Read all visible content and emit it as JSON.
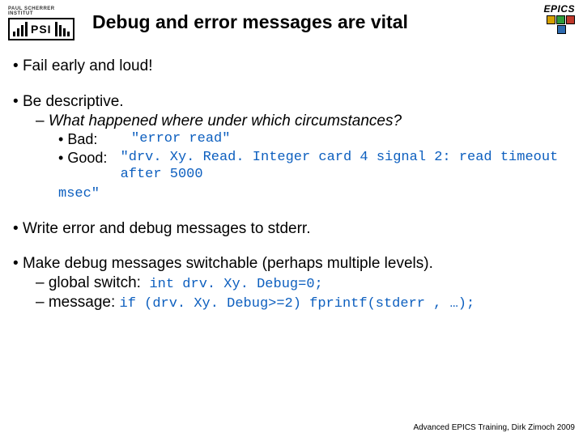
{
  "header": {
    "psi_institute": "PAUL SCHERRER INSTITUT",
    "psi_text": "PSI",
    "title": "Debug and error messages are vital",
    "epics": "EPICS"
  },
  "bullets": {
    "b1": "Fail early and loud!",
    "b2": "Be descriptive.",
    "b2a": "What happened where under which circumstances?",
    "bad_label": "Bad:",
    "bad_code": "\"error read\"",
    "good_label": "Good:",
    "good_code": "\"drv. Xy. Read. Integer card 4 signal 2: read timeout after 5000",
    "good_tail": "msec\"",
    "b3": "Write error and debug messages to stderr.",
    "b4": "Make debug messages switchable (perhaps multiple levels).",
    "b4a_pre": "global switch:",
    "b4a_code": "int drv. Xy. Debug=0;",
    "b4b_pre": "message:",
    "b4b_code": "if (drv. Xy. Debug>=2) fprintf(stderr , …);"
  },
  "footer": "Advanced EPICS Training, Dirk Zimoch 2009"
}
